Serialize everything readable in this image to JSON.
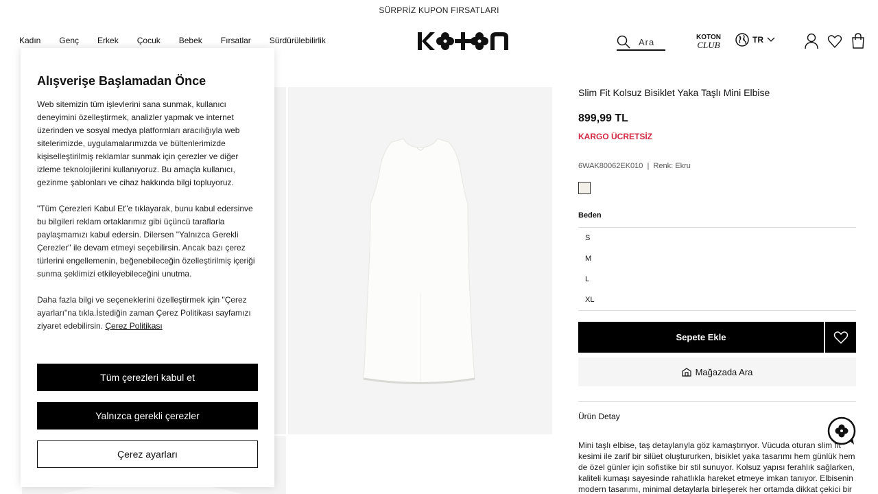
{
  "promo_bar": {
    "text": "SÜRPRİZ KUPON FIRSATLARI"
  },
  "nav": {
    "items": [
      "Kadın",
      "Genç",
      "Erkek",
      "Çocuk",
      "Bebek",
      "Fırsatlar",
      "Sürdürülebilirlik"
    ]
  },
  "brand": {
    "logo_text": "KOTON",
    "club_top": "KOTON",
    "club_bottom": "CLUB"
  },
  "search": {
    "placeholder": "Ara"
  },
  "language": {
    "code": "TR"
  },
  "cookie": {
    "title": "Alışverişe Başlamadan Önce",
    "paragraph1": "Web sitemizin tüm işlevlerini sana sunmak, kullanıcı deneyimini özelleştirmek, analizler yapmak ve internet üzerinden ve sosyal medya platformları aracılığıyla web sitelerimizde, uygulamalarımızda ve bültenlerimizde kişiselleştirilmiş reklamlar sunmak için çerezler ve diğer izleme teknolojilerini kullanıyoruz. Bu amaçla kullanıcı, gezinme şablonları ve cihaz hakkında bilgi topluyoruz.",
    "paragraph2": "\"Tüm Çerezleri Kabul Et\"e tıklayarak, bunu kabul edersinve bu bilgileri reklam ortaklarımız gibi üçüncü taraflarla paylaşmamızı kabul edersin. Dilersen \"Yalnızca Gerekli Çerezler\" ile devam etmeyi seçebilirsin. Ancak bazı çerez türlerini engellemenin, beğenebileceğin özelleştirilmiş içeriği sunma şeklimizi etkileyebileceğini unutma.",
    "paragraph3": "Daha fazla bilgi ve seçeneklerini özelleştirmek için \"Çerez ayarları\"na tıkla.İstediğin zaman Çerez Politikası sayfamızı ziyaret edebilirsin. ",
    "policy_link": "Çerez Politikası",
    "accept_all": "Tüm çerezleri kabul et",
    "only_required": "Yalnızca gerekli çerezler",
    "settings": "Çerez ayarları"
  },
  "product": {
    "title": "Slim Fit Kolsuz Bisiklet Yaka Taşlı Mini Elbise",
    "price": "899,99 TL",
    "shipping": "KARGO ÜCRETSİZ",
    "sku": "6WAK80062EK010",
    "color_label": "Renk: Ekru",
    "size_label": "Beden",
    "sizes": [
      "S",
      "M",
      "L",
      "XL"
    ],
    "add_to_cart": "Sepete Ekle",
    "store_search": "Mağazada Ara",
    "detail_heading": "Ürün Detay",
    "description": "Mini taşlı elbise, taş detaylarıyla göz kamaştırıyor. Vücuda oturan slim fit kesimi ile zarif bir silüet oluştururken, bisiklet yaka tasarımı hem günlük hem de özel günler için sofistike bir stil sunuyor. Kolsuz yapısı ferahlık sağlarken, kaliteli kumaşı sayesinde rahatlıkla hareket etmeye imkan tanıyor. Elbisenin modern tasarımı, minimal detaylarla birleşerek her ortamda dikkat çekici bir"
  },
  "colors": {
    "accent_red": "#d4263f",
    "black": "#000000",
    "swatch": "#f2f0e9"
  }
}
